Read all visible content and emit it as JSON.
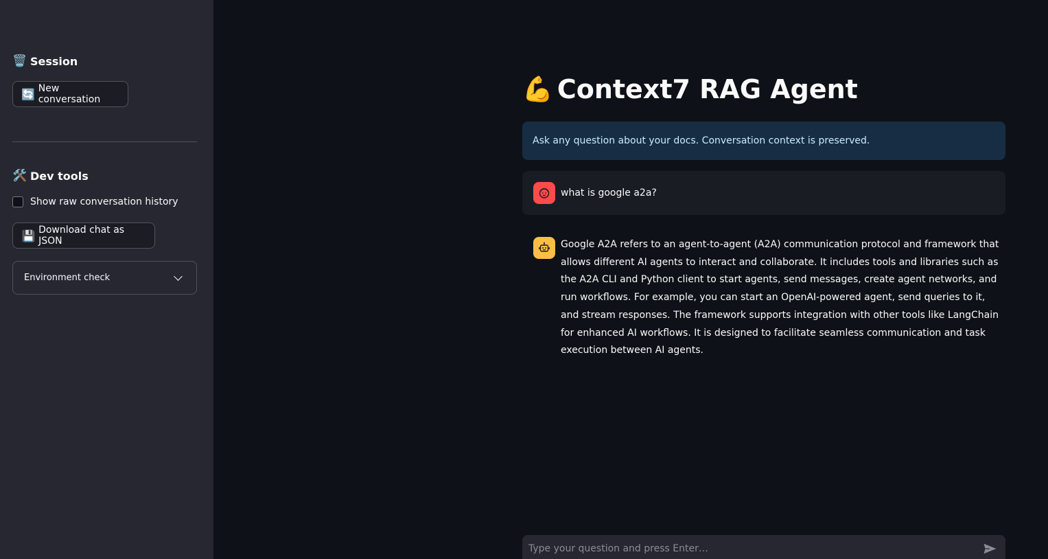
{
  "sidebar": {
    "session": {
      "heading": "Session",
      "heading_icon": "wastebasket-icon",
      "new_conversation_label": "New conversation",
      "new_conversation_icon": "refresh-icon"
    },
    "dev_tools": {
      "heading": "Dev tools",
      "heading_icon": "hammer-wrench-icon",
      "show_history_label": "Show raw conversation history",
      "show_history_checked": false,
      "download_label": "Download chat as JSON",
      "download_icon": "floppy-disk-icon",
      "env_check_label": "Environment check"
    }
  },
  "main": {
    "title": "Context7 RAG Agent",
    "title_icon": "flexed-biceps-icon",
    "info": "Ask any question about your docs. Conversation context is preserved.",
    "messages": [
      {
        "role": "user",
        "avatar_icon": "user-face-icon",
        "text": "what is google a2a?"
      },
      {
        "role": "assistant",
        "avatar_icon": "robot-icon",
        "text": "Google A2A refers to an agent-to-agent (A2A) communication protocol and framework that allows different AI agents to interact and collaborate. It includes tools and libraries such as the A2A CLI and Python client to start agents, send messages, create agent networks, and run workflows. For example, you can start an OpenAI-powered agent, send queries to it, and stream responses. The framework supports integration with other tools like LangChain for enhanced AI workflows. It is designed to facilitate seamless communication and task execution between AI agents."
      }
    ],
    "chat_input": {
      "placeholder": "Type your question and press Enter…",
      "value": ""
    }
  },
  "colors": {
    "background": "#0e1117",
    "sidebar": "#262730",
    "info_bg": "#172d43",
    "info_text": "#c7ebff",
    "user_avatar": "#ff4b4b",
    "bot_avatar": "#ffbd45"
  }
}
